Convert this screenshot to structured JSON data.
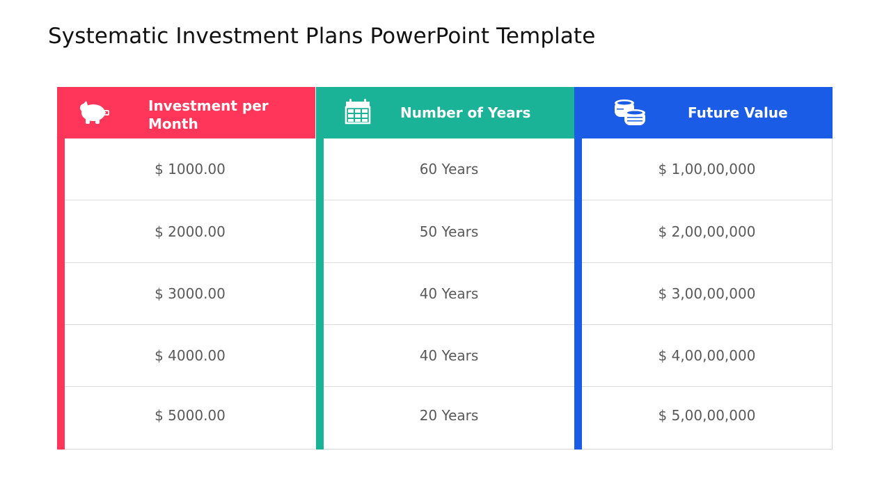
{
  "slide": {
    "title": "Systematic Investment Plans PowerPoint Template"
  },
  "colors": {
    "investment": "#FF365A",
    "years": "#1BB398",
    "future": "#1A5CE6",
    "cell_text": "#595959",
    "divider": "#DCDCDC"
  },
  "columns": [
    {
      "header": "Investment per Month",
      "icon": "piggy-bank-icon",
      "values": [
        "$ 1000.00",
        "$ 2000.00",
        "$ 3000.00",
        "$ 4000.00",
        "$ 5000.00"
      ]
    },
    {
      "header": "Number of Years",
      "icon": "calendar-icon",
      "values": [
        "60 Years",
        "50 Years",
        "40 Years",
        "40 Years",
        "20 Years"
      ]
    },
    {
      "header": "Future Value",
      "icon": "coins-icon",
      "values": [
        "$ 1,00,00,000",
        "$ 2,00,00,000",
        "$ 3,00,00,000",
        "$ 4,00,00,000",
        "$ 5,00,00,000"
      ]
    }
  ]
}
